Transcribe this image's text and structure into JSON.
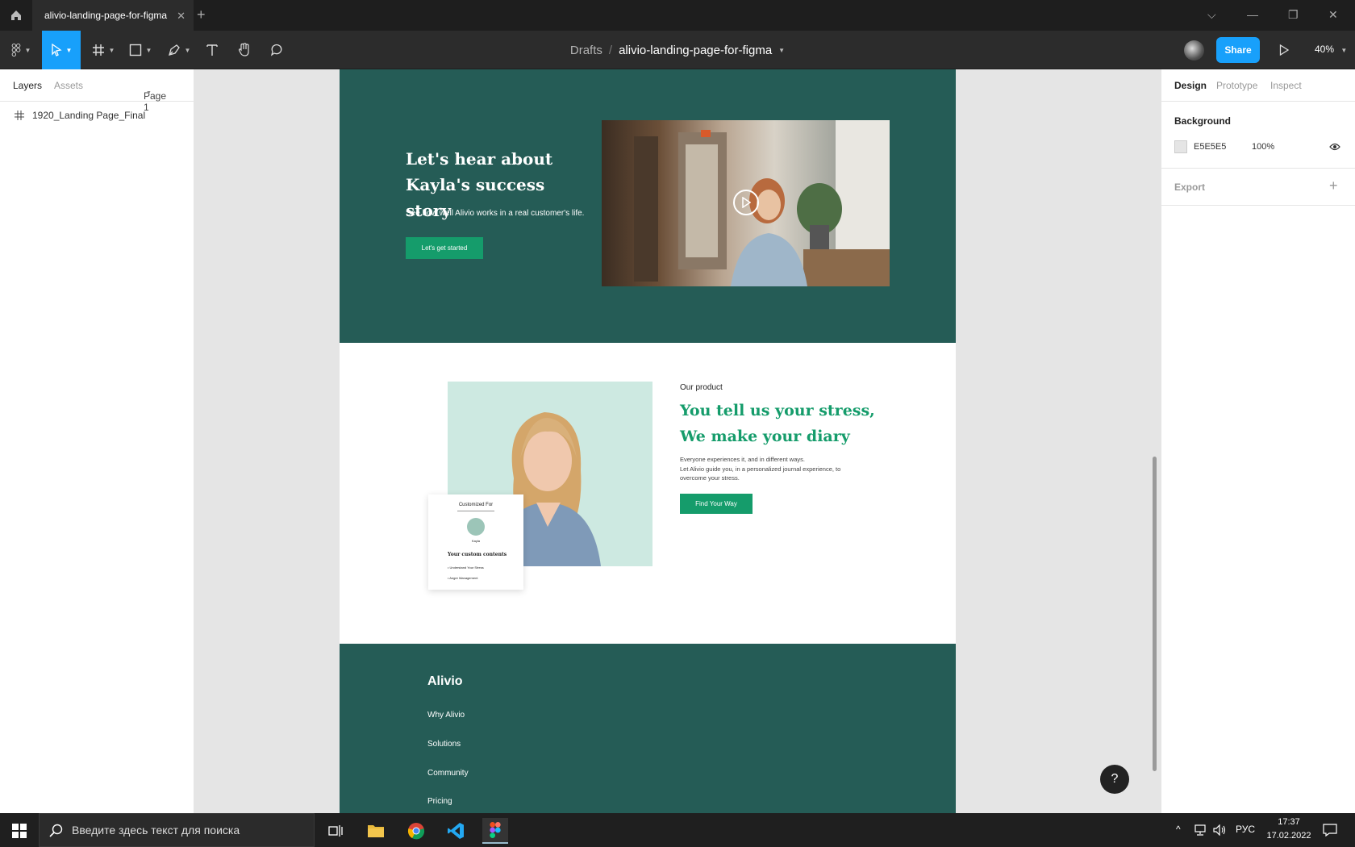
{
  "titlebar": {
    "tab_title": "alivio-landing-page-for-figma",
    "close_glyph": "✕",
    "new_tab_glyph": "+",
    "window_controls": {
      "chevron": "⌵",
      "minimize": "—",
      "restore": "❐",
      "close": "✕"
    }
  },
  "toolbar": {
    "breadcrumb_drafts": "Drafts",
    "breadcrumb_sep": "/",
    "file_name": "alivio-landing-page-for-figma",
    "share_label": "Share",
    "zoom_level": "40%",
    "icons": [
      "figma-menu-icon",
      "move-tool-icon",
      "frame-tool-icon",
      "rectangle-tool-icon",
      "pen-tool-icon",
      "text-tool-icon",
      "hand-tool-icon",
      "comment-tool-icon",
      "present-icon"
    ]
  },
  "left_panel": {
    "tabs": [
      "Layers",
      "Assets"
    ],
    "page_selector": "Page 1",
    "layers": [
      {
        "name": "1920_Landing Page_Final",
        "icon": "frame-icon"
      }
    ]
  },
  "right_panel": {
    "tabs": [
      "Design",
      "Prototype",
      "Inspect"
    ],
    "background_title": "Background",
    "background_hex": "E5E5E5",
    "background_opacity": "100%",
    "export_title": "Export",
    "add_glyph": "+"
  },
  "canvas": {
    "hero": {
      "title_line1": "Let's hear about",
      "title_line2": "Kayla's success story",
      "subtitle": "See how well Alivio works in a real customer's life.",
      "button": "Let's get started"
    },
    "product": {
      "eyebrow": "Our product",
      "title_line1": "You tell us your stress,",
      "title_line2": "We make your diary",
      "body_line1": "Everyone experiences it, and in different ways.",
      "body_line2": "Let Alivio guide you, in a personalized journal experience, to overcome your stress.",
      "button": "Find Your Way",
      "card": {
        "title": "Customized For",
        "name": "Kayla",
        "heading": "Your custom contents",
        "items": [
          "• Understand Your Stress",
          "• Anger Management"
        ]
      }
    },
    "footer": {
      "brand": "Alivio",
      "nav": [
        "Why Alivio",
        "Solutions",
        "Community",
        "Pricing"
      ]
    },
    "help_glyph": "?"
  },
  "taskbar": {
    "search_placeholder": "Введите здесь текст для поиска",
    "language": "РУС",
    "time": "17:37",
    "date": "17.02.2022"
  },
  "colors": {
    "accent_blue": "#18a0fb",
    "alivio_dark_green": "#255c56",
    "alivio_green": "#159c6b",
    "mint": "#cde9e1"
  }
}
